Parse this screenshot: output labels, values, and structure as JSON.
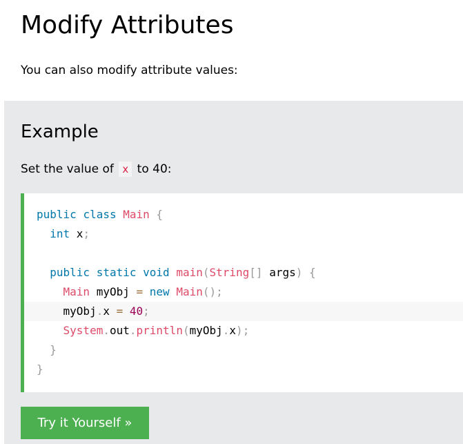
{
  "section": {
    "title": "Modify Attributes",
    "intro": "You can also modify attribute values:"
  },
  "example": {
    "title": "Example",
    "desc_before": "Set the value of ",
    "desc_code": "x",
    "desc_after": " to 40:",
    "accent_color": "#4caf50",
    "code_lines": [
      [
        {
          "t": "public",
          "c": "kw"
        },
        {
          "t": " ",
          "c": ""
        },
        {
          "t": "class",
          "c": "kw"
        },
        {
          "t": " ",
          "c": ""
        },
        {
          "t": "Main",
          "c": "cls"
        },
        {
          "t": " ",
          "c": ""
        },
        {
          "t": "{",
          "c": "pn"
        }
      ],
      [
        {
          "t": "  ",
          "c": ""
        },
        {
          "t": "int",
          "c": "kw"
        },
        {
          "t": " x",
          "c": ""
        },
        {
          "t": ";",
          "c": "pn"
        }
      ],
      [],
      [
        {
          "t": "  ",
          "c": ""
        },
        {
          "t": "public",
          "c": "kw"
        },
        {
          "t": " ",
          "c": ""
        },
        {
          "t": "static",
          "c": "kw"
        },
        {
          "t": " ",
          "c": ""
        },
        {
          "t": "void",
          "c": "kw"
        },
        {
          "t": " ",
          "c": ""
        },
        {
          "t": "main",
          "c": "cls"
        },
        {
          "t": "(",
          "c": "pn"
        },
        {
          "t": "String",
          "c": "cls"
        },
        {
          "t": "[",
          "c": "pn"
        },
        {
          "t": "]",
          "c": "pn"
        },
        {
          "t": " args",
          "c": ""
        },
        {
          "t": ")",
          "c": "pn"
        },
        {
          "t": " ",
          "c": ""
        },
        {
          "t": "{",
          "c": "pn"
        }
      ],
      [
        {
          "t": "    ",
          "c": ""
        },
        {
          "t": "Main",
          "c": "cls"
        },
        {
          "t": " myObj ",
          "c": ""
        },
        {
          "t": "=",
          "c": "op"
        },
        {
          "t": " ",
          "c": ""
        },
        {
          "t": "new",
          "c": "kw"
        },
        {
          "t": " ",
          "c": ""
        },
        {
          "t": "Main",
          "c": "cls"
        },
        {
          "t": "(",
          "c": "pn"
        },
        {
          "t": ")",
          "c": "pn"
        },
        {
          "t": ";",
          "c": "pn"
        }
      ],
      [
        {
          "t": "    myObj",
          "c": ""
        },
        {
          "t": ".",
          "c": "pn"
        },
        {
          "t": "x ",
          "c": ""
        },
        {
          "t": "=",
          "c": "op"
        },
        {
          "t": " ",
          "c": ""
        },
        {
          "t": "40",
          "c": "num"
        },
        {
          "t": ";",
          "c": "pn"
        }
      ],
      [
        {
          "t": "    ",
          "c": ""
        },
        {
          "t": "System",
          "c": "cls"
        },
        {
          "t": ".",
          "c": "pn"
        },
        {
          "t": "out",
          "c": ""
        },
        {
          "t": ".",
          "c": "pn"
        },
        {
          "t": "println",
          "c": "cls"
        },
        {
          "t": "(",
          "c": "pn"
        },
        {
          "t": "myObj",
          "c": ""
        },
        {
          "t": ".",
          "c": "pn"
        },
        {
          "t": "x",
          "c": ""
        },
        {
          "t": ")",
          "c": "pn"
        },
        {
          "t": ";",
          "c": "pn"
        }
      ],
      [
        {
          "t": "  ",
          "c": ""
        },
        {
          "t": "}",
          "c": "pn"
        }
      ],
      [
        {
          "t": "}",
          "c": "pn"
        }
      ]
    ],
    "highlighted_line": 5,
    "button_label": "Try it Yourself »"
  }
}
